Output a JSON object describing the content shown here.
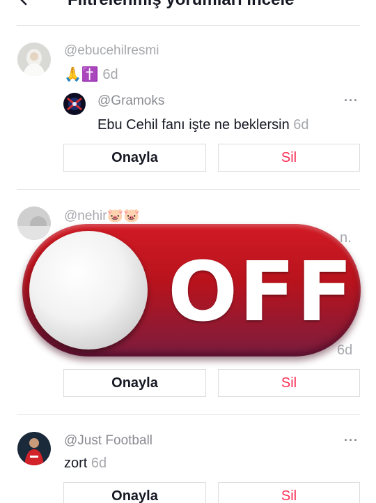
{
  "header": {
    "title": "Filtrelenmiş yorumları incele"
  },
  "comments": [
    {
      "username": "@ebucehilresmi",
      "text_emoji": "🙏✝️",
      "time": "6d",
      "reply": {
        "username": "@Gramoks",
        "text": "Ebu Cehil fanı işte ne beklersin",
        "time": "6d",
        "more": "···"
      },
      "approve": "Onayla",
      "delete": "Sil"
    },
    {
      "username": "@nehir🐷🐷",
      "partial_text_end": "n.",
      "time": "6d",
      "approve": "Onayla",
      "delete": "Sil"
    },
    {
      "username": "@Just Football",
      "text": "zort",
      "time": "6d",
      "more": "···",
      "approve": "Onayla",
      "delete": "Sil"
    }
  ],
  "overlay": {
    "label": "OFF",
    "state": "off",
    "colors": {
      "track": "#c0141f",
      "knob": "#f2f2f2"
    }
  },
  "icons": {
    "back": "chevron-left-icon",
    "more": "more-dots-icon"
  }
}
